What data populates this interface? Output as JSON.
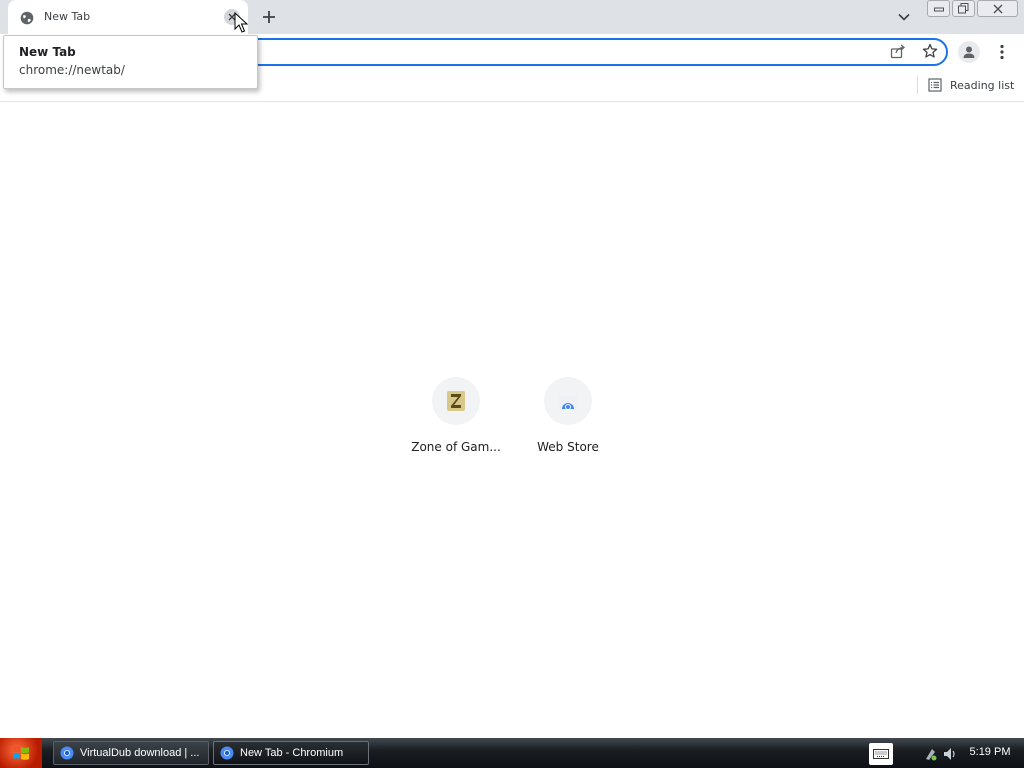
{
  "tab": {
    "title": "New Tab",
    "favicon": "globe-icon",
    "close_icon": "close-icon"
  },
  "tabstrip": {
    "new_tab_icon": "plus-icon",
    "tab_search_icon": "chevron-down-icon"
  },
  "window_controls": [
    "minimize-icon",
    "restore-icon",
    "close-icon"
  ],
  "hover_card": {
    "title": "New Tab",
    "url": "chrome://newtab/"
  },
  "toolbar": {
    "share_icon": "share-icon",
    "bookmark_icon": "star-icon",
    "profile_icon": "person-icon",
    "menu_icon": "kebab-menu-icon"
  },
  "bookmarks_bar": {
    "reading_list_label": "Reading list",
    "reading_list_icon": "reading-list-icon"
  },
  "shortcuts": [
    {
      "label": "Zone of Gam...",
      "icon": "zone-of-games-icon"
    },
    {
      "label": "Web Store",
      "icon": "web-store-icon"
    }
  ],
  "taskbar": {
    "start_icon": "windows-logo-icon",
    "tasks": [
      {
        "label": "VirtualDub download | ...",
        "icon": "chromium-icon",
        "active": false
      },
      {
        "label": "New Tab - Chromium",
        "icon": "chromium-icon",
        "active": true
      }
    ],
    "keyboard_icon": "keyboard-icon",
    "tray_icons": [
      "network-icon",
      "volume-icon"
    ],
    "clock": "5:19 PM"
  },
  "colors": {
    "tabstrip": "#dee1e6",
    "omnibox_focus": "#1a73e8",
    "taskbar": "#1a1e22"
  }
}
